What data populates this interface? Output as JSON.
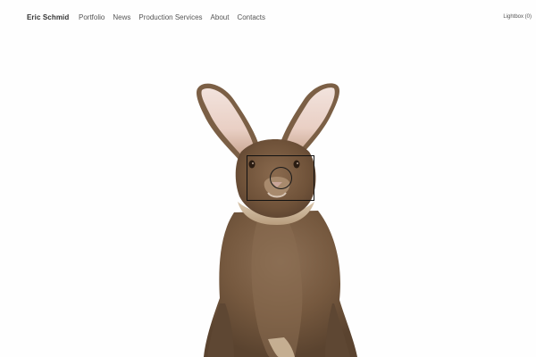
{
  "header": {
    "brand": "Eric Schmid",
    "nav": [
      "Portfolio",
      "News",
      "Production Services",
      "About",
      "Contacts"
    ],
    "lightbox": "Lightbox (0)"
  },
  "photo": {
    "subject": "rabbit-photo",
    "background_color": "#fefefe",
    "fur_color": "#7a5e43"
  },
  "zoom": {
    "cursor_icon": "magnifier-circle-icon"
  }
}
